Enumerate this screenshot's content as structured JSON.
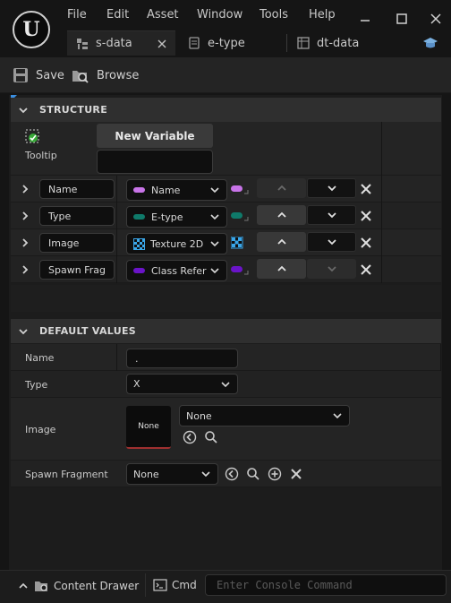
{
  "menu": [
    "File",
    "Edit",
    "Asset",
    "Window",
    "Tools",
    "Help"
  ],
  "tabs": [
    {
      "label": "s-data",
      "active": true,
      "icon": "struct-icon"
    },
    {
      "label": "e-type",
      "active": false,
      "icon": "enum-icon"
    },
    {
      "label": "dt-data",
      "active": false,
      "icon": "datatable-icon"
    }
  ],
  "toolbar": {
    "save_label": "Save",
    "browse_label": "Browse"
  },
  "structure": {
    "header": "STRUCTURE",
    "new_variable_label": "New Variable",
    "tooltip_label": "Tooltip",
    "tooltip_value": "",
    "fields": [
      {
        "name": "Name",
        "type": "Name",
        "type_color": "#c874e8",
        "container_color": "#c874e8"
      },
      {
        "name": "Type",
        "type": "E-type",
        "type_color": "#0f7a6a",
        "container_color": "#0f7a6a"
      },
      {
        "name": "Image",
        "type": "Texture 2D",
        "type_color": "#3aa6e8",
        "container_color": "#3aa6e8"
      },
      {
        "name": "Spawn Frag",
        "type": "Class Refer",
        "type_color": "#6a14c8",
        "container_color": "#6a14c8"
      }
    ]
  },
  "defaults": {
    "header": "DEFAULT VALUES",
    "name_label": "Name",
    "name_value": ".",
    "type_label": "Type",
    "type_value": "X",
    "image_label": "Image",
    "image_thumb": "None",
    "image_value": "None",
    "spawn_label": "Spawn Fragment",
    "spawn_value": "None"
  },
  "bottom": {
    "content_drawer_label": "Content Drawer",
    "cmd_label": "Cmd",
    "console_placeholder": "Enter Console Command"
  }
}
